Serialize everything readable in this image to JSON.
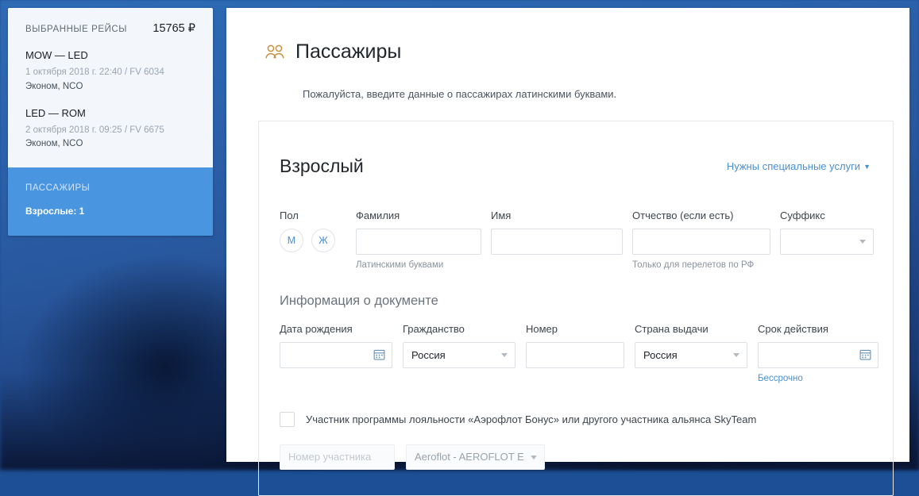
{
  "sidebar": {
    "flights_title": "ВЫБРАННЫЕ РЕЙСЫ",
    "total_price": "15765 ₽",
    "legs": [
      {
        "route": "MOW — LED",
        "meta": "1 октября 2018 г. 22:40 / FV 6034",
        "fare": "Эконом, NCO"
      },
      {
        "route": "LED — ROM",
        "meta": "2 октября 2018 г. 09:25 / FV 6675",
        "fare": "Эконом, NCO"
      }
    ],
    "passengers_title": "ПАССАЖИРЫ",
    "passengers_rows": [
      "Взрослые: 1"
    ]
  },
  "header": {
    "icon": "passengers-icon",
    "title": "Пассажиры",
    "subtitle": "Пожалуйста, введите данные о пассажирах латинскими буквами."
  },
  "passenger_card": {
    "title": "Взрослый",
    "special_services_link": "Нужны специальные услуги",
    "special_services_caret": "▼",
    "name_row": {
      "gender": {
        "label": "Пол",
        "male": "М",
        "female": "Ж"
      },
      "last_name": {
        "label": "Фамилия",
        "value": "",
        "placeholder": "",
        "hint": "Латинскими буквами"
      },
      "first_name": {
        "label": "Имя",
        "value": "",
        "placeholder": "",
        "hint": ""
      },
      "middle_name": {
        "label": "Отчество (если есть)",
        "value": "",
        "placeholder": "",
        "hint": "Только для перелетов по РФ"
      },
      "suffix": {
        "label": "Суффикс",
        "value": "",
        "caret": "▼"
      }
    },
    "document_section": {
      "title": "Информация о документе",
      "birth_date": {
        "label": "Дата рождения",
        "value": "",
        "placeholder": "",
        "icon": "calendar-icon"
      },
      "citizenship": {
        "label": "Гражданство",
        "value": "Россия"
      },
      "number": {
        "label": "Номер",
        "value": "",
        "placeholder": ""
      },
      "issuing_country": {
        "label": "Страна выдачи",
        "value": "Россия"
      },
      "expiry": {
        "label": "Срок действия",
        "value": "",
        "placeholder": "",
        "icon": "calendar-icon",
        "sub_link": "Бессрочно"
      }
    },
    "loyalty": {
      "checkbox_label": "Участник программы лояльности «Аэрофлот Бонус» или другого участника альянса SkyTeam",
      "checked": false,
      "number_placeholder": "Номер участника",
      "number_value": "",
      "program_value": "Aeroflot - AEROFLOT E",
      "program_caret": "▼"
    }
  },
  "colors": {
    "accent_blue": "#4a8fd4",
    "sidebar_pax_blue": "#4a95e0",
    "icon_gold": "#c8913f",
    "page_bg": "#1d4f96"
  }
}
